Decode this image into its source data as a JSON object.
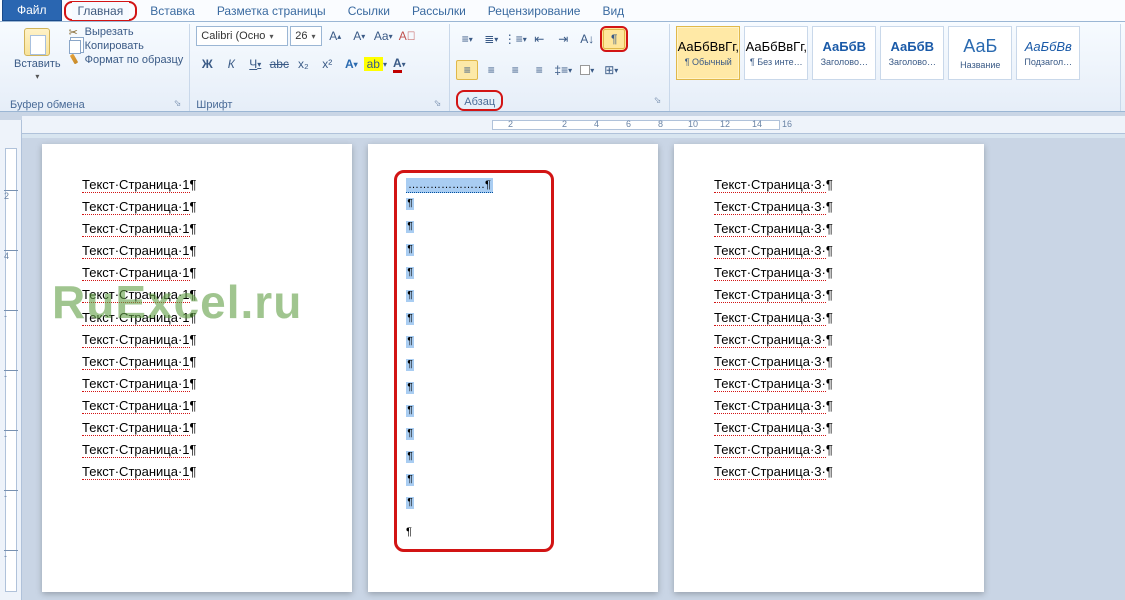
{
  "tabs": {
    "file": "Файл",
    "home": "Главная",
    "insert": "Вставка",
    "layout": "Разметка страницы",
    "refs": "Ссылки",
    "mail": "Рассылки",
    "review": "Рецензирование",
    "view": "Вид"
  },
  "clipboard": {
    "paste": "Вставить",
    "cut": "Вырезать",
    "copy": "Копировать",
    "format": "Формат по образцу",
    "title": "Буфер обмена"
  },
  "font": {
    "name": "Calibri (Осно",
    "size": "26",
    "title": "Шрифт",
    "bold": "Ж",
    "italic": "К",
    "underline": "Ч",
    "strike": "abc",
    "sub": "x₂",
    "sup": "x²"
  },
  "paragraph": {
    "title": "Абзац"
  },
  "styles": {
    "preview": "АаБбВвГг,",
    "preview_serif": "АаБбВ",
    "preview_big": "АаБ",
    "preview_sub": "АаБбВв",
    "normal": "¶ Обычный",
    "nointerval": "¶ Без инте…",
    "heading1": "Заголово…",
    "heading2": "Заголово…",
    "title": "Название",
    "subtitle": "Подзагол…"
  },
  "ruler": {
    "nums": [
      "2",
      "2",
      "4",
      "6",
      "8",
      "10",
      "12",
      "14",
      "16"
    ]
  },
  "page1": {
    "lines": [
      "Текст·Страница·1¶",
      "Текст·Страница·1¶",
      "Текст·Страница·1¶",
      "Текст·Страница·1¶",
      "Текст·Страница·1¶",
      "Текст·Страница·1¶",
      "Текст·Страница·1¶",
      "Текст·Страница·1¶",
      "Текст·Страница·1¶",
      "Текст·Страница·1¶",
      "Текст·Страница·1¶",
      "Текст·Страница·1¶",
      "Текст·Страница·1¶",
      "Текст·Страница·1¶"
    ]
  },
  "page3": {
    "lines": [
      "Текст·Страница·3·¶",
      "Текст·Страница·3·¶",
      "Текст·Страница·3·¶",
      "Текст·Страница·3·¶",
      "Текст·Страница·3·¶",
      "Текст·Страница·3·¶",
      "Текст·Страница·3·¶",
      "Текст·Страница·3·¶",
      "Текст·Страница·3·¶",
      "Текст·Страница·3·¶",
      "Текст·Страница·3·¶",
      "Текст·Страница·3·¶",
      "Текст·Страница·3·¶",
      "Текст·Страница·3·¶"
    ]
  },
  "page2": {
    "selected_text": "…………………¶"
  },
  "watermark": "RuExcel.ru",
  "corner": "⌐"
}
